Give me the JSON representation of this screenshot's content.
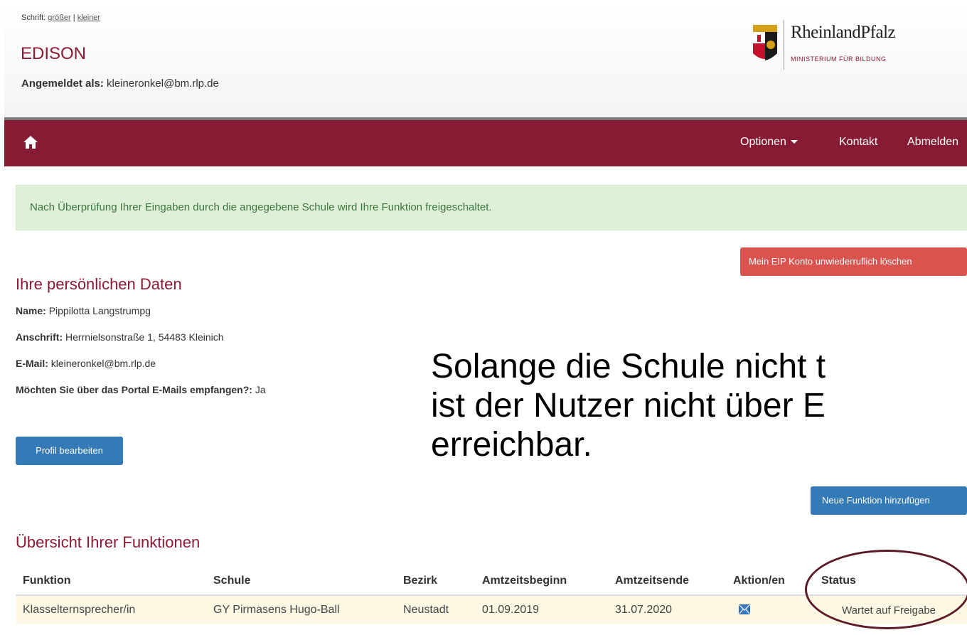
{
  "header": {
    "font_prefix": "Schrift:",
    "font_bigger": "größer",
    "font_sep": " | ",
    "font_smaller": "kleiner",
    "app_title": "EDISON",
    "logged_label": "Angemeldet als:",
    "logged_email": "kleineronkel@bm.rlp.de",
    "logo_name": "RheinlandPfalz",
    "logo_sub": "MINISTERIUM FÜR BILDUNG"
  },
  "nav": {
    "home_icon": "home-icon",
    "options": "Optionen",
    "contact": "Kontakt",
    "logout": "Abmelden"
  },
  "alert": "Nach Überprüfung Ihrer Eingaben durch die angegebene Schule wird Ihre Funktion freigeschaltet.",
  "delete_button": "Mein EIP Konto unwiederruflich löschen",
  "personal": {
    "title": "Ihre persönlichen Daten",
    "name_label": "Name:",
    "name": "Pippilotta Langstrumpg",
    "address_label": "Anschrift:",
    "address": "Herrnielsonstraße 1, 54483 Kleinich",
    "email_label": "E-Mail:",
    "email": "kleineronkel@bm.rlp.de",
    "mails_label": "Möchten Sie über das Portal E-Mails empfangen?:",
    "mails_value": "Ja",
    "edit_button": "Profil bearbeiten"
  },
  "overlay": {
    "line1": "Solange die Schule nicht t",
    "line2": "ist der Nutzer nicht über E",
    "line3": "erreichbar."
  },
  "new_function_button": "Neue Funktion hinzufügen",
  "functions": {
    "title": "Übersicht Ihrer Funktionen",
    "headers": [
      "Funktion",
      "Schule",
      "Bezirk",
      "Amtzeitsbeginn",
      "Amtzeitsende",
      "Aktion/en",
      "Status"
    ],
    "rows": [
      [
        "Klasselternsprecher/in",
        "GY Pirmasens Hugo-Ball",
        "Neustadt",
        "01.09.2019",
        "31.07.2020",
        "",
        "Wartet auf Freigabe"
      ]
    ]
  },
  "colors": {
    "brand": "#861c33",
    "alert_bg": "#dff0d8",
    "danger": "#d9534f",
    "primary": "#337ab7"
  }
}
